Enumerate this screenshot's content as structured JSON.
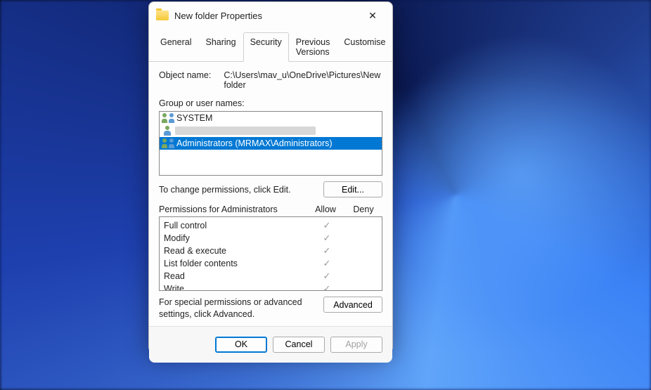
{
  "dialog": {
    "title": "New folder Properties"
  },
  "tabs": {
    "general": "General",
    "sharing": "Sharing",
    "security": "Security",
    "previous_versions": "Previous Versions",
    "customise": "Customise",
    "active": "security"
  },
  "security": {
    "object_name_label": "Object name:",
    "object_name_value": "C:\\Users\\mav_u\\OneDrive\\Pictures\\New folder",
    "group_label": "Group or user names:",
    "groups": [
      {
        "name": "SYSTEM",
        "icon": "dual",
        "selected": false,
        "blurred": false
      },
      {
        "name": "",
        "icon": "single",
        "selected": false,
        "blurred": true
      },
      {
        "name": "Administrators (MRMAX\\Administrators)",
        "icon": "dual",
        "selected": true,
        "blurred": false
      }
    ],
    "edit_hint": "To change permissions, click Edit.",
    "edit_button": "Edit...",
    "permissions_label": "Permissions for Administrators",
    "col_allow": "Allow",
    "col_deny": "Deny",
    "permissions": [
      {
        "name": "Full control",
        "allow": true,
        "deny": false
      },
      {
        "name": "Modify",
        "allow": true,
        "deny": false
      },
      {
        "name": "Read & execute",
        "allow": true,
        "deny": false
      },
      {
        "name": "List folder contents",
        "allow": true,
        "deny": false
      },
      {
        "name": "Read",
        "allow": true,
        "deny": false
      },
      {
        "name": "Write",
        "allow": true,
        "deny": false
      }
    ],
    "special_text": "For special permissions or advanced settings, click Advanced.",
    "advanced_button": "Advanced"
  },
  "footer": {
    "ok": "OK",
    "cancel": "Cancel",
    "apply": "Apply"
  }
}
